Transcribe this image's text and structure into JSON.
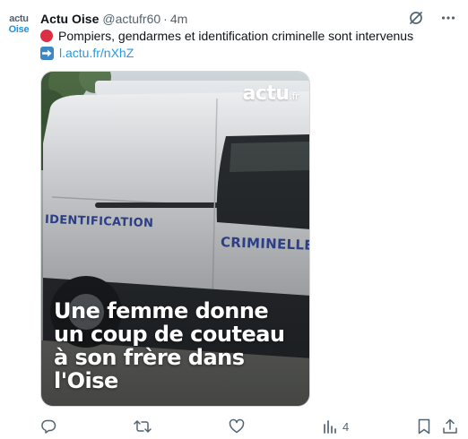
{
  "account": {
    "avatar_line1": "actu",
    "avatar_line2": "Oise",
    "name": "Actu Oise",
    "handle": "@actufr60",
    "separator": "·",
    "time": "4m"
  },
  "tweet": {
    "text_line1": "Pompiers, gendarmes et identification criminelle sont intervenus",
    "link": "l.actu.fr/nXhZ",
    "emoji1": "red-circle",
    "emoji2": "right-arrow-box"
  },
  "media": {
    "logo_main": "actu",
    "logo_suffix": ".fr",
    "van_label_left": "IDENTIFICATION",
    "van_label_right": "CRIMINELLE",
    "headline": "Une femme donne un coup de couteau à son frère dans l'Oise"
  },
  "actions": {
    "reply_icon": "reply-icon",
    "retweet_icon": "retweet-icon",
    "like_icon": "heart-icon",
    "views_icon": "views-icon",
    "views_count": "4",
    "bookmark_icon": "bookmark-icon",
    "share_icon": "share-icon"
  },
  "colors": {
    "link": "#1d9bf0",
    "secondary_text": "#536471",
    "van_lettering": "#2b3e86"
  }
}
